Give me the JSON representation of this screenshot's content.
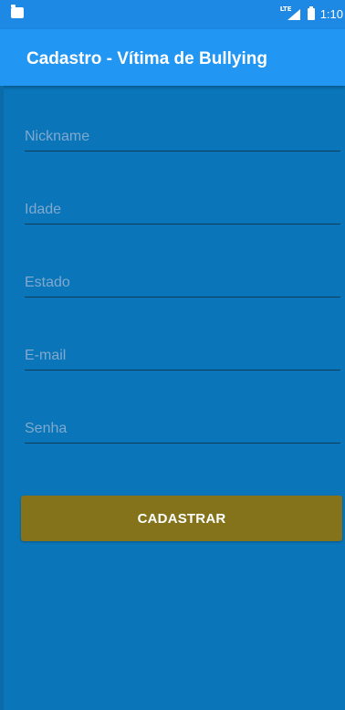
{
  "status_bar": {
    "network_label": "LTE",
    "time": "1:10"
  },
  "toolbar": {
    "title": "Cadastro - Vítima de Bullying"
  },
  "form": {
    "fields": [
      {
        "placeholder": "Nickname",
        "value": ""
      },
      {
        "placeholder": "Idade",
        "value": ""
      },
      {
        "placeholder": "Estado",
        "value": ""
      },
      {
        "placeholder": "E-mail",
        "value": ""
      },
      {
        "placeholder": "Senha",
        "value": ""
      }
    ],
    "submit_label": "CADASTRAR"
  },
  "colors": {
    "background": "#0A75B8",
    "toolbar": "#2196F3",
    "status_bar": "#1E88E5",
    "button": "#84731A",
    "hint_text": "#7FA9CF"
  }
}
